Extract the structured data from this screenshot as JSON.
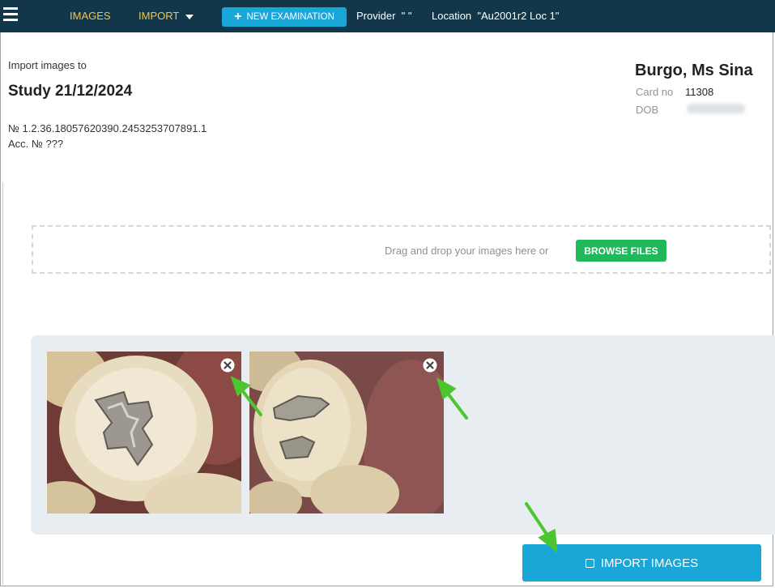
{
  "topbar": {
    "menu_icon": "hamburger-menu-icon",
    "images_label": "IMAGES",
    "import_label": "IMPORT",
    "new_exam_label": "NEW EXAMINATION",
    "provider_label": "Provider",
    "provider_value": "\" \"",
    "location_label": "Location",
    "location_value": "\"Au2001r2 Loc 1\""
  },
  "study": {
    "import_to": "Import images to",
    "title": "Study 21/12/2024",
    "uid": "№ 1.2.36.18057620390.2453253707891.1",
    "accession": "Acc. № ???"
  },
  "patient": {
    "name": "Burgo, Ms Sina",
    "card_label": "Card no",
    "card_value": "11308",
    "dob_label": "DOB"
  },
  "dropzone": {
    "hint": "Drag and drop your images here or",
    "browse_label": "BROWSE FILES"
  },
  "gallery": {
    "remove_icon": "close-circle-icon"
  },
  "actions": {
    "import_label": "IMPORT IMAGES",
    "import_icon": "import-icon"
  },
  "colors": {
    "topbar": "#12374a",
    "nav_text": "#f2c64b",
    "primary": "#19a7d8",
    "browse": "#1fb85a",
    "annotation_arrow": "#4cc62f"
  }
}
